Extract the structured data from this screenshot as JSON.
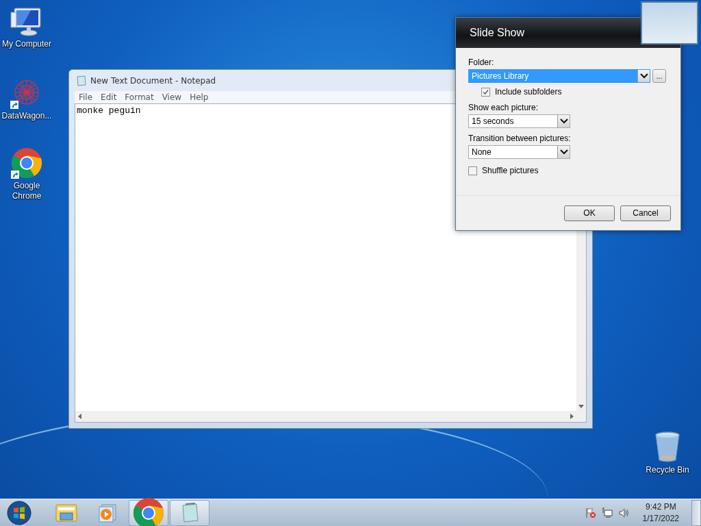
{
  "desktop_icons": [
    {
      "label": "My Computer",
      "kind": "computer",
      "shortcut": false
    },
    {
      "label": "DataWagon...",
      "kind": "datawagon",
      "shortcut": true
    },
    {
      "label": "Google Chrome",
      "kind": "chrome",
      "shortcut": true
    },
    {
      "label": "Recycle Bin",
      "kind": "recycle",
      "shortcut": false
    }
  ],
  "notepad": {
    "title": "New Text Document - Notepad",
    "menu": [
      "File",
      "Edit",
      "Format",
      "View",
      "Help"
    ],
    "text": "monke peguin"
  },
  "dialog": {
    "title": "Slide Show",
    "folder_label": "Folder:",
    "folder": {
      "value": "Pictures Library",
      "selected": true
    },
    "browse": "...",
    "include_subfolders": {
      "label": "Include subfolders",
      "checked": true
    },
    "show_each_label": "Show each picture:",
    "show_each": "15 seconds",
    "transition_label": "Transition between pictures:",
    "transition": "None",
    "shuffle": {
      "label": "Shuffle pictures",
      "checked": false
    },
    "buttons": [
      "OK",
      "Cancel"
    ]
  },
  "taskbar": {
    "items": [
      {
        "kind": "explorer",
        "open": false
      },
      {
        "kind": "media",
        "open": false
      },
      {
        "kind": "chrome",
        "open": true
      },
      {
        "kind": "notepad",
        "open": true
      }
    ],
    "time": "9:42 PM",
    "date": "1/17/2022"
  }
}
